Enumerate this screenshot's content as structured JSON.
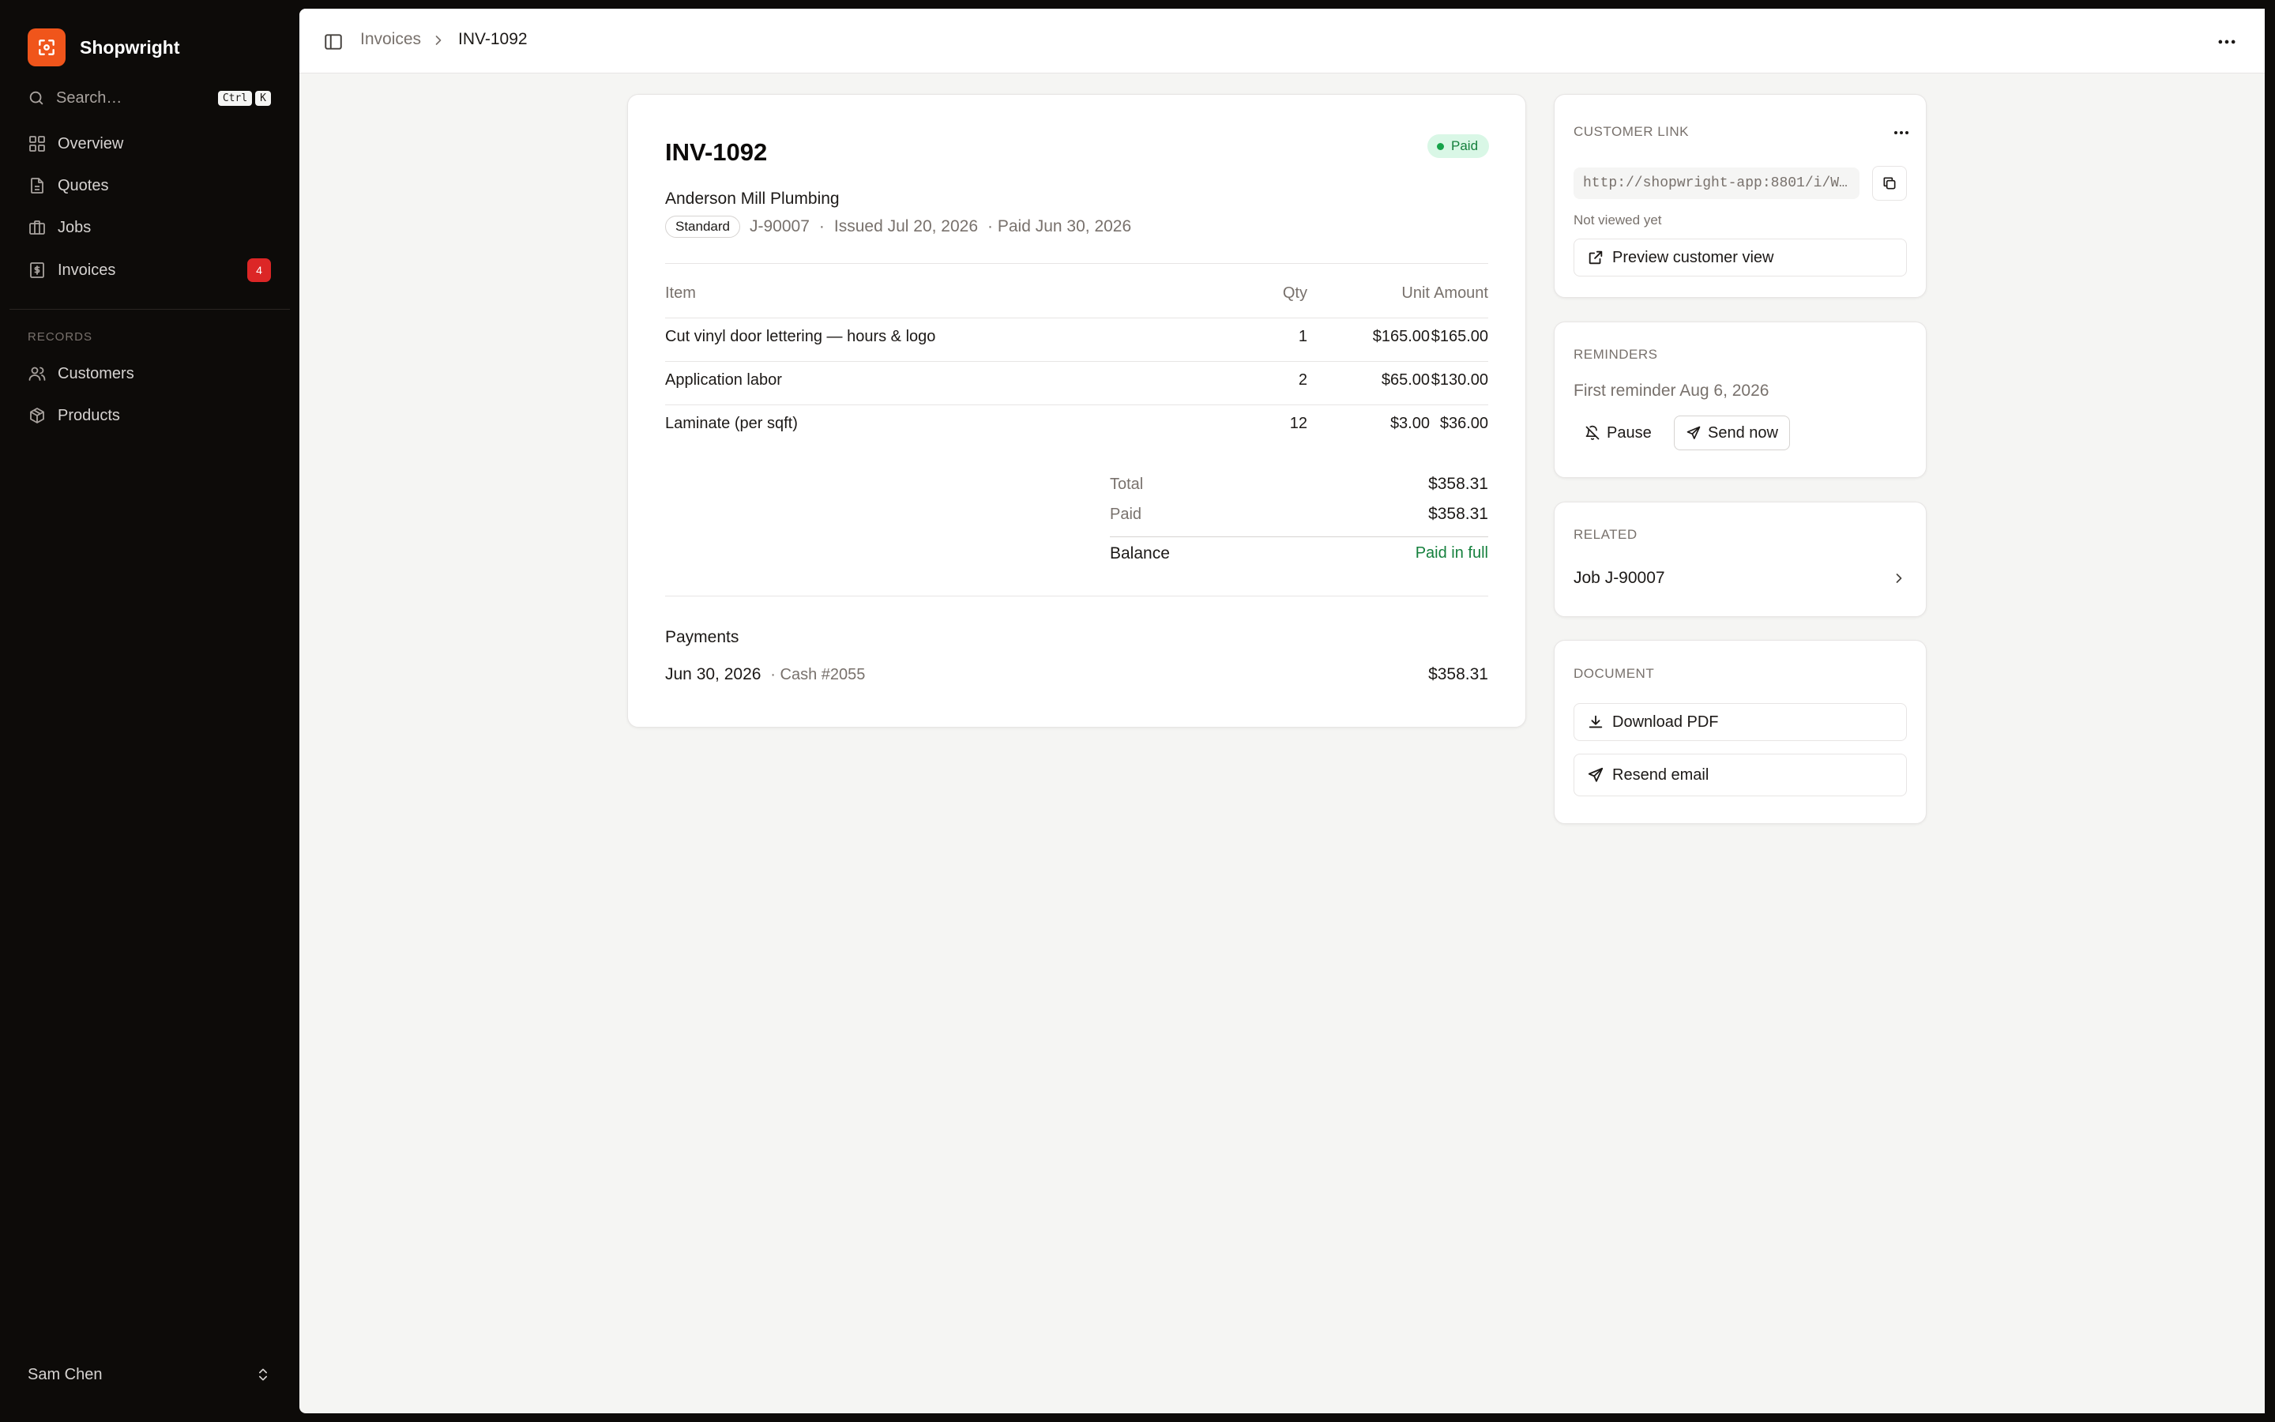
{
  "app": {
    "name": "Shopwright"
  },
  "search": {
    "placeholder": "Search…",
    "shortcut": [
      "Ctrl",
      "K"
    ]
  },
  "sidebar": {
    "nav": [
      {
        "label": "Overview",
        "icon": "grid-icon"
      },
      {
        "label": "Quotes",
        "icon": "document-icon"
      },
      {
        "label": "Jobs",
        "icon": "briefcase-icon"
      },
      {
        "label": "Invoices",
        "icon": "dollar-document-icon",
        "badge": "4"
      }
    ],
    "records_heading": "RECORDS",
    "records": [
      {
        "label": "Customers",
        "icon": "users-icon"
      },
      {
        "label": "Products",
        "icon": "package-icon"
      }
    ],
    "user": {
      "name": "Sam Chen"
    }
  },
  "breadcrumb": {
    "parent": "Invoices",
    "current": "INV-1092"
  },
  "invoice": {
    "number": "INV-1092",
    "status": "Paid",
    "customer": "Anderson Mill Plumbing",
    "type": "Standard",
    "job": "J-90007",
    "sep": "·",
    "issued": "Issued Jul 20, 2026",
    "paid_on": "· Paid Jun 30, 2026",
    "columns": {
      "item": "Item",
      "qty": "Qty",
      "unit": "Unit",
      "amount": "Amount"
    },
    "lines": [
      {
        "item": "Cut vinyl door lettering — hours & logo",
        "qty": "1",
        "unit": "$165.00",
        "amount": "$165.00"
      },
      {
        "item": "Application labor",
        "qty": "2",
        "unit": "$65.00",
        "amount": "$130.00"
      },
      {
        "item": "Laminate (per sqft)",
        "qty": "12",
        "unit": "$3.00",
        "amount": "$36.00"
      }
    ],
    "totals": {
      "total_label": "Total",
      "total": "$358.31",
      "paid_label": "Paid",
      "paid": "$358.31",
      "balance_label": "Balance",
      "balance": "Paid in full"
    },
    "payments": {
      "heading": "Payments",
      "items": [
        {
          "date": "Jun 30, 2026",
          "method": "· Cash #2055",
          "amount": "$358.31"
        }
      ]
    }
  },
  "customer_link": {
    "heading": "CUSTOMER LINK",
    "url": "http://shopwright-app:8801/i/W…",
    "viewed": "Not viewed yet",
    "preview_label": "Preview customer view"
  },
  "reminders": {
    "heading": "REMINDERS",
    "first": "First reminder Aug 6, 2026",
    "pause_label": "Pause",
    "send_label": "Send now"
  },
  "related": {
    "heading": "RELATED",
    "job_label": "Job J-90007"
  },
  "document": {
    "heading": "DOCUMENT",
    "download_label": "Download PDF",
    "resend_label": "Resend email"
  },
  "colors": {
    "brand": "#f0551b",
    "paid_green": "#15803d",
    "badge_red": "#dc2626"
  }
}
